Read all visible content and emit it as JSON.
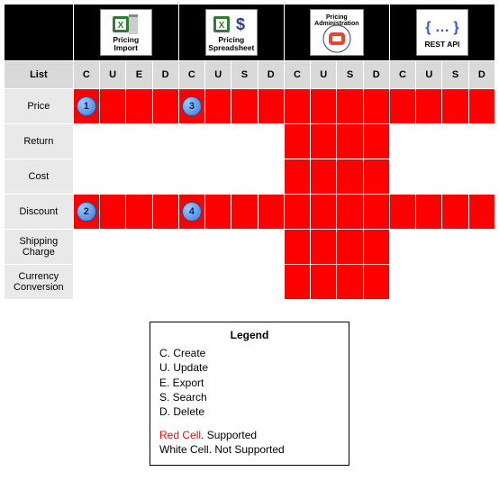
{
  "groups": [
    {
      "label": "Pricing Import",
      "cols": [
        "C",
        "U",
        "E",
        "D"
      ]
    },
    {
      "label": "Pricing Spreadsheet",
      "cols": [
        "C",
        "U",
        "S",
        "D"
      ]
    },
    {
      "label": "Pricing Administration",
      "cols": [
        "C",
        "U",
        "S",
        "D"
      ]
    },
    {
      "label": "REST API",
      "cols": [
        "C",
        "U",
        "S",
        "D"
      ]
    }
  ],
  "list_header": "List",
  "rows": [
    {
      "name": "Price",
      "support": [
        1,
        1,
        1,
        1,
        1,
        1,
        1,
        1,
        1,
        1,
        1,
        1,
        1,
        1,
        1,
        1
      ],
      "badges": {
        "0": "1",
        "4": "3"
      }
    },
    {
      "name": "Return",
      "support": [
        0,
        0,
        0,
        0,
        0,
        0,
        0,
        0,
        1,
        1,
        1,
        1,
        0,
        0,
        0,
        0
      ]
    },
    {
      "name": "Cost",
      "support": [
        0,
        0,
        0,
        0,
        0,
        0,
        0,
        0,
        1,
        1,
        1,
        1,
        0,
        0,
        0,
        0
      ]
    },
    {
      "name": "Discount",
      "support": [
        1,
        1,
        1,
        1,
        1,
        1,
        1,
        1,
        1,
        1,
        1,
        1,
        1,
        1,
        1,
        1
      ],
      "badges": {
        "0": "2",
        "4": "4"
      }
    },
    {
      "name": "Shipping Charge",
      "support": [
        0,
        0,
        0,
        0,
        0,
        0,
        0,
        0,
        1,
        1,
        1,
        1,
        0,
        0,
        0,
        0
      ]
    },
    {
      "name": "Currency Conversion",
      "support": [
        0,
        0,
        0,
        0,
        0,
        0,
        0,
        0,
        1,
        1,
        1,
        1,
        0,
        0,
        0,
        0
      ]
    }
  ],
  "legend": {
    "title": "Legend",
    "codes": [
      "C. Create",
      "U. Update",
      "E. Export",
      "S. Search",
      "D. Delete"
    ],
    "supported_prefix": "Red Cell",
    "supported_suffix": ". Supported",
    "not_supported": "White Cell. Not Supported"
  },
  "chart_data": {
    "type": "table",
    "title": "Pricing List operation support matrix",
    "column_groups": [
      {
        "tool": "Pricing Import",
        "ops": [
          "Create",
          "Update",
          "Export",
          "Delete"
        ]
      },
      {
        "tool": "Pricing Spreadsheet",
        "ops": [
          "Create",
          "Update",
          "Search",
          "Delete"
        ]
      },
      {
        "tool": "Pricing Administration",
        "ops": [
          "Create",
          "Update",
          "Search",
          "Delete"
        ]
      },
      {
        "tool": "REST API",
        "ops": [
          "Create",
          "Update",
          "Search",
          "Delete"
        ]
      }
    ],
    "rows": [
      "Price",
      "Return",
      "Cost",
      "Discount",
      "Shipping Charge",
      "Currency Conversion"
    ],
    "matrix_supported": [
      [
        1,
        1,
        1,
        1,
        1,
        1,
        1,
        1,
        1,
        1,
        1,
        1,
        1,
        1,
        1,
        1
      ],
      [
        0,
        0,
        0,
        0,
        0,
        0,
        0,
        0,
        1,
        1,
        1,
        1,
        0,
        0,
        0,
        0
      ],
      [
        0,
        0,
        0,
        0,
        0,
        0,
        0,
        0,
        1,
        1,
        1,
        1,
        0,
        0,
        0,
        0
      ],
      [
        1,
        1,
        1,
        1,
        1,
        1,
        1,
        1,
        1,
        1,
        1,
        1,
        1,
        1,
        1,
        1
      ],
      [
        0,
        0,
        0,
        0,
        0,
        0,
        0,
        0,
        1,
        1,
        1,
        1,
        0,
        0,
        0,
        0
      ],
      [
        0,
        0,
        0,
        0,
        0,
        0,
        0,
        0,
        1,
        1,
        1,
        1,
        0,
        0,
        0,
        0
      ]
    ],
    "callouts": [
      {
        "row": "Price",
        "tool": "Pricing Import",
        "op": "Create",
        "n": 1
      },
      {
        "row": "Price",
        "tool": "Pricing Spreadsheet",
        "op": "Create",
        "n": 3
      },
      {
        "row": "Discount",
        "tool": "Pricing Import",
        "op": "Create",
        "n": 2
      },
      {
        "row": "Discount",
        "tool": "Pricing Spreadsheet",
        "op": "Create",
        "n": 4
      }
    ]
  }
}
